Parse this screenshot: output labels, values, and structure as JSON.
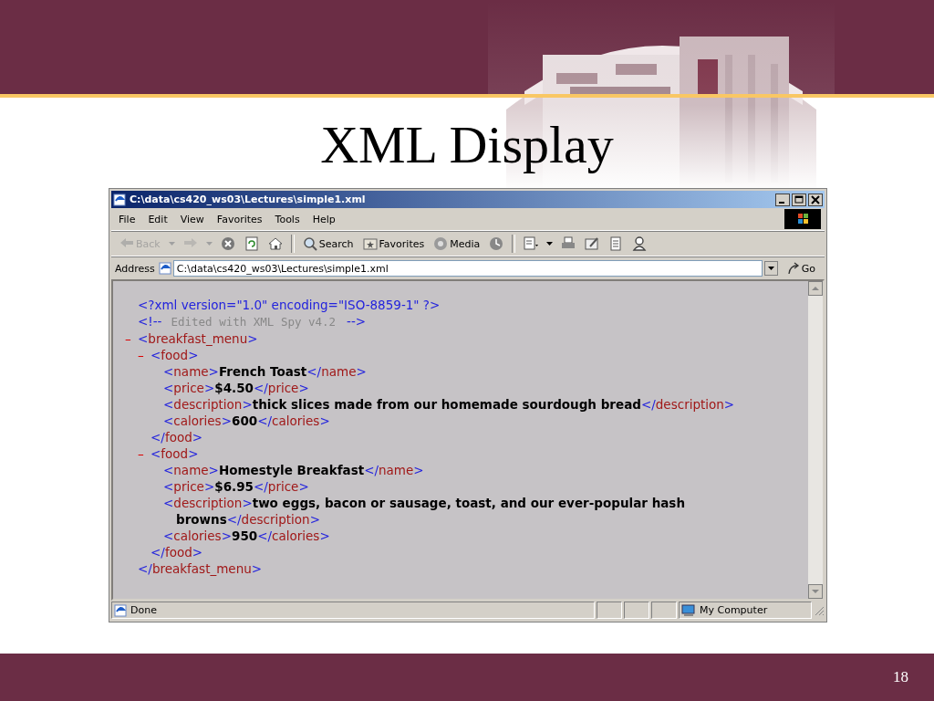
{
  "slide": {
    "title": "XML Display",
    "page_number": "18"
  },
  "window": {
    "title": "C:\\data\\cs420_ws03\\Lectures\\simple1.xml"
  },
  "menu": [
    {
      "label": "File"
    },
    {
      "label": "Edit"
    },
    {
      "label": "View"
    },
    {
      "label": "Favorites"
    },
    {
      "label": "Tools"
    },
    {
      "label": "Help"
    }
  ],
  "toolbar": [
    {
      "kind": "back",
      "label": "Back",
      "disabled": true
    },
    {
      "kind": "forward",
      "disabled": true
    },
    {
      "kind": "stop",
      "disabled": false
    },
    {
      "kind": "refresh",
      "disabled": false
    },
    {
      "kind": "home",
      "disabled": false
    },
    {
      "kind": "separator"
    },
    {
      "kind": "search",
      "label": "Search",
      "disabled": false
    },
    {
      "kind": "favorites",
      "label": "Favorites",
      "disabled": false
    },
    {
      "kind": "media",
      "label": "Media",
      "disabled": false
    },
    {
      "kind": "history",
      "disabled": false
    },
    {
      "kind": "separator"
    },
    {
      "kind": "mail",
      "disabled": false
    },
    {
      "kind": "print",
      "disabled": false
    },
    {
      "kind": "edit",
      "disabled": false
    },
    {
      "kind": "discuss",
      "disabled": false
    },
    {
      "kind": "messenger",
      "disabled": false
    }
  ],
  "address": {
    "label": "Address",
    "value": "C:\\data\\cs420_ws03\\Lectures\\simple1.xml",
    "go": "Go"
  },
  "document": {
    "prolog": [
      {
        "kind": "pi",
        "text": "<?xml version=\"1.0\" encoding=\"ISO-8859-1\" ?>"
      },
      {
        "kind": "comment",
        "open": "<!--",
        "text": "Edited with XML Spy v4.2",
        "close": "-->"
      }
    ],
    "root": {
      "toggle": "–",
      "expanded": true,
      "open": "<breakfast_menu>",
      "close": "</breakfast_menu>",
      "children": [
        {
          "toggle": "–",
          "expanded": true,
          "open": "<food>",
          "close": "</food>",
          "children": [
            {
              "open": "<name>",
              "value": "French Toast",
              "close": "</name>"
            },
            {
              "open": "<price>",
              "value": "$4.50",
              "close": "</price>"
            },
            {
              "open": "<description>",
              "value": "thick slices made from our homemade sourdough bread",
              "close": "</description>"
            },
            {
              "open": "<calories>",
              "value": "600",
              "close": "</calories>"
            }
          ]
        },
        {
          "toggle": "–",
          "expanded": true,
          "open": "<food>",
          "close": "</food>",
          "children": [
            {
              "open": "<name>",
              "value": "Homestyle Breakfast",
              "close": "</name>"
            },
            {
              "open": "<price>",
              "value": "$6.95",
              "close": "</price>"
            },
            {
              "open": "<description>",
              "value": "two eggs, bacon or sausage, toast, and our ever-popular hash browns",
              "close": "</description>"
            },
            {
              "open": "<calories>",
              "value": "950",
              "close": "</calories>"
            }
          ]
        }
      ]
    }
  },
  "status_bar": {
    "text": "Done",
    "zone": "My Computer"
  }
}
